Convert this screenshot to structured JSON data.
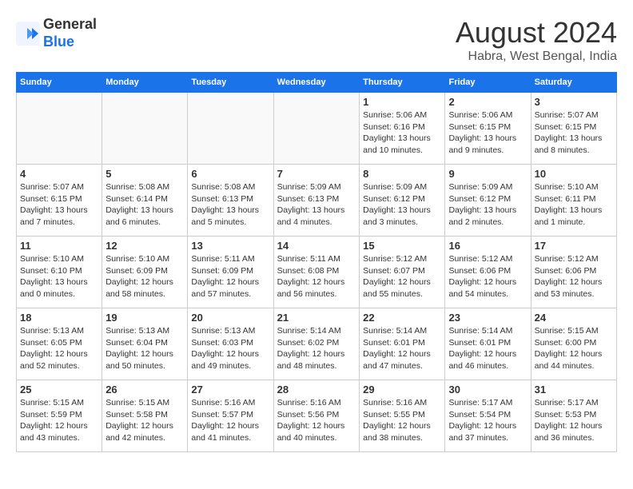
{
  "header": {
    "logo_line1": "General",
    "logo_line2": "Blue",
    "title": "August 2024",
    "subtitle": "Habra, West Bengal, India"
  },
  "days_of_week": [
    "Sunday",
    "Monday",
    "Tuesday",
    "Wednesday",
    "Thursday",
    "Friday",
    "Saturday"
  ],
  "weeks": [
    [
      {
        "day": "",
        "empty": true
      },
      {
        "day": "",
        "empty": true
      },
      {
        "day": "",
        "empty": true
      },
      {
        "day": "",
        "empty": true
      },
      {
        "day": "1",
        "info": "Sunrise: 5:06 AM\nSunset: 6:16 PM\nDaylight: 13 hours\nand 10 minutes."
      },
      {
        "day": "2",
        "info": "Sunrise: 5:06 AM\nSunset: 6:15 PM\nDaylight: 13 hours\nand 9 minutes."
      },
      {
        "day": "3",
        "info": "Sunrise: 5:07 AM\nSunset: 6:15 PM\nDaylight: 13 hours\nand 8 minutes."
      }
    ],
    [
      {
        "day": "4",
        "info": "Sunrise: 5:07 AM\nSunset: 6:15 PM\nDaylight: 13 hours\nand 7 minutes."
      },
      {
        "day": "5",
        "info": "Sunrise: 5:08 AM\nSunset: 6:14 PM\nDaylight: 13 hours\nand 6 minutes."
      },
      {
        "day": "6",
        "info": "Sunrise: 5:08 AM\nSunset: 6:13 PM\nDaylight: 13 hours\nand 5 minutes."
      },
      {
        "day": "7",
        "info": "Sunrise: 5:09 AM\nSunset: 6:13 PM\nDaylight: 13 hours\nand 4 minutes."
      },
      {
        "day": "8",
        "info": "Sunrise: 5:09 AM\nSunset: 6:12 PM\nDaylight: 13 hours\nand 3 minutes."
      },
      {
        "day": "9",
        "info": "Sunrise: 5:09 AM\nSunset: 6:12 PM\nDaylight: 13 hours\nand 2 minutes."
      },
      {
        "day": "10",
        "info": "Sunrise: 5:10 AM\nSunset: 6:11 PM\nDaylight: 13 hours\nand 1 minute."
      }
    ],
    [
      {
        "day": "11",
        "info": "Sunrise: 5:10 AM\nSunset: 6:10 PM\nDaylight: 13 hours\nand 0 minutes."
      },
      {
        "day": "12",
        "info": "Sunrise: 5:10 AM\nSunset: 6:09 PM\nDaylight: 12 hours\nand 58 minutes."
      },
      {
        "day": "13",
        "info": "Sunrise: 5:11 AM\nSunset: 6:09 PM\nDaylight: 12 hours\nand 57 minutes."
      },
      {
        "day": "14",
        "info": "Sunrise: 5:11 AM\nSunset: 6:08 PM\nDaylight: 12 hours\nand 56 minutes."
      },
      {
        "day": "15",
        "info": "Sunrise: 5:12 AM\nSunset: 6:07 PM\nDaylight: 12 hours\nand 55 minutes."
      },
      {
        "day": "16",
        "info": "Sunrise: 5:12 AM\nSunset: 6:06 PM\nDaylight: 12 hours\nand 54 minutes."
      },
      {
        "day": "17",
        "info": "Sunrise: 5:12 AM\nSunset: 6:06 PM\nDaylight: 12 hours\nand 53 minutes."
      }
    ],
    [
      {
        "day": "18",
        "info": "Sunrise: 5:13 AM\nSunset: 6:05 PM\nDaylight: 12 hours\nand 52 minutes."
      },
      {
        "day": "19",
        "info": "Sunrise: 5:13 AM\nSunset: 6:04 PM\nDaylight: 12 hours\nand 50 minutes."
      },
      {
        "day": "20",
        "info": "Sunrise: 5:13 AM\nSunset: 6:03 PM\nDaylight: 12 hours\nand 49 minutes."
      },
      {
        "day": "21",
        "info": "Sunrise: 5:14 AM\nSunset: 6:02 PM\nDaylight: 12 hours\nand 48 minutes."
      },
      {
        "day": "22",
        "info": "Sunrise: 5:14 AM\nSunset: 6:01 PM\nDaylight: 12 hours\nand 47 minutes."
      },
      {
        "day": "23",
        "info": "Sunrise: 5:14 AM\nSunset: 6:01 PM\nDaylight: 12 hours\nand 46 minutes."
      },
      {
        "day": "24",
        "info": "Sunrise: 5:15 AM\nSunset: 6:00 PM\nDaylight: 12 hours\nand 44 minutes."
      }
    ],
    [
      {
        "day": "25",
        "info": "Sunrise: 5:15 AM\nSunset: 5:59 PM\nDaylight: 12 hours\nand 43 minutes."
      },
      {
        "day": "26",
        "info": "Sunrise: 5:15 AM\nSunset: 5:58 PM\nDaylight: 12 hours\nand 42 minutes."
      },
      {
        "day": "27",
        "info": "Sunrise: 5:16 AM\nSunset: 5:57 PM\nDaylight: 12 hours\nand 41 minutes."
      },
      {
        "day": "28",
        "info": "Sunrise: 5:16 AM\nSunset: 5:56 PM\nDaylight: 12 hours\nand 40 minutes."
      },
      {
        "day": "29",
        "info": "Sunrise: 5:16 AM\nSunset: 5:55 PM\nDaylight: 12 hours\nand 38 minutes."
      },
      {
        "day": "30",
        "info": "Sunrise: 5:17 AM\nSunset: 5:54 PM\nDaylight: 12 hours\nand 37 minutes."
      },
      {
        "day": "31",
        "info": "Sunrise: 5:17 AM\nSunset: 5:53 PM\nDaylight: 12 hours\nand 36 minutes."
      }
    ]
  ]
}
